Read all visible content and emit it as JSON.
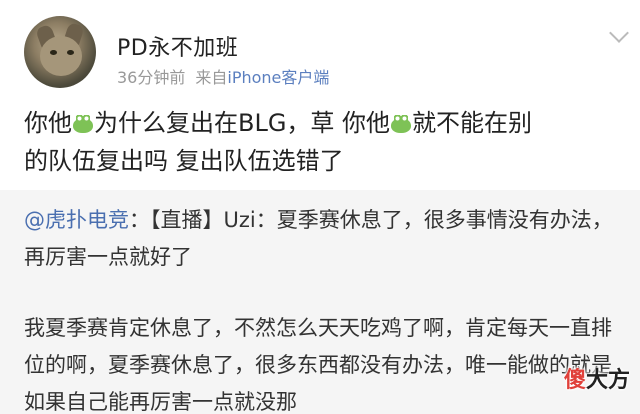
{
  "post": {
    "username": "PD永不加班",
    "time": "36分钟前",
    "source_prefix": "来自",
    "source": "iPhone客户端",
    "text_line1_a": "你他",
    "text_line1_b": "为什么复出在BLG，草 你他",
    "text_line1_c": "就不能在别",
    "text_line2": "的队伍复出吗 复出队伍选错了"
  },
  "quote": {
    "mention": "@虎扑电竞",
    "text1": "：【直播】Uzi：夏季赛休息了，很多事情没有办法，再厉害一点就好了",
    "para2": "我夏季赛肯定休息了，不然怎么天天吃鸡了啊，肯定每天一直排位的啊，夏季赛休息了，很多东西都没有办法，唯一能做的就是如果自己能再厉害一点就没那"
  },
  "watermark": {
    "char1": "傻",
    "rest": "大方"
  },
  "colors": {
    "link": "#5b7fbf",
    "quote_bg": "#f5f5f5"
  }
}
